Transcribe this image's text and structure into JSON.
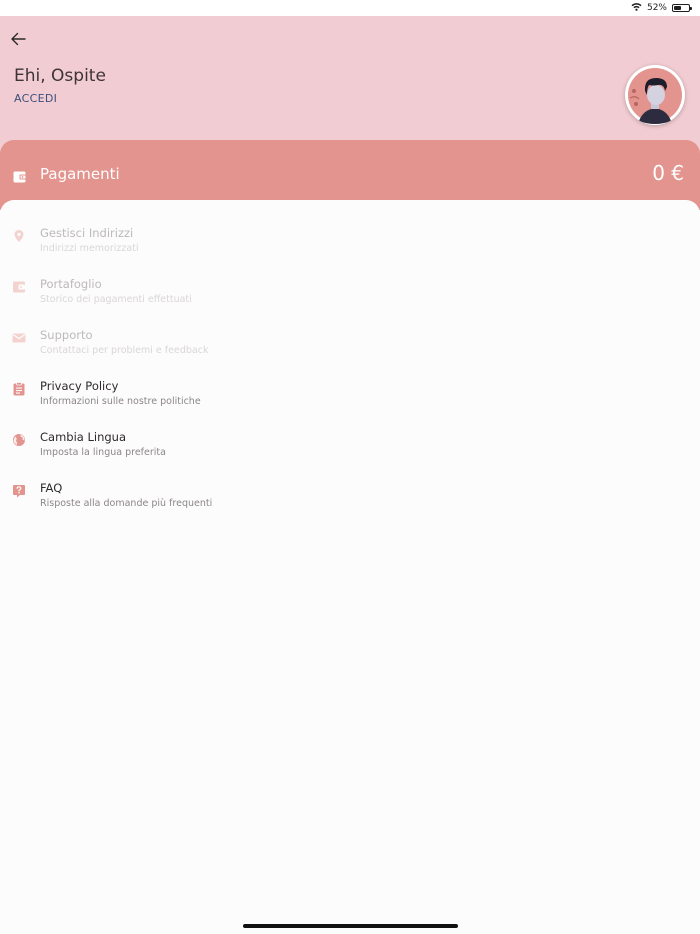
{
  "status_bar": {
    "battery_text": "52%",
    "battery_level": 0.52
  },
  "header": {
    "greeting": "Ehi, Ospite",
    "login_label": "ACCEDI"
  },
  "payments": {
    "label": "Pagamenti",
    "amount": "0 €"
  },
  "menu": [
    {
      "title": "Gestisci Indirizzi",
      "subtitle": "Indirizzi memorizzati",
      "icon": "location-pin-icon",
      "enabled": false
    },
    {
      "title": "Portafoglio",
      "subtitle": "Storico dei pagamenti effettuati",
      "icon": "wallet-icon",
      "enabled": false
    },
    {
      "title": "Supporto",
      "subtitle": "Contattaci per problemi e feedback",
      "icon": "mail-icon",
      "enabled": false
    },
    {
      "title": "Privacy Policy",
      "subtitle": "Informazioni sulle nostre politiche",
      "icon": "clipboard-icon",
      "enabled": true
    },
    {
      "title": "Cambia Lingua",
      "subtitle": "Imposta la lingua preferita",
      "icon": "globe-icon",
      "enabled": true
    },
    {
      "title": "FAQ",
      "subtitle": "Risposte alla domande più frequenti",
      "icon": "help-icon",
      "enabled": true
    }
  ],
  "colors": {
    "header_bg": "#f1ccd2",
    "accent": "#e3948e",
    "login_link": "#3c4f7c",
    "icon_active": "#e3948e",
    "icon_disabled": "#f3d3d0"
  }
}
